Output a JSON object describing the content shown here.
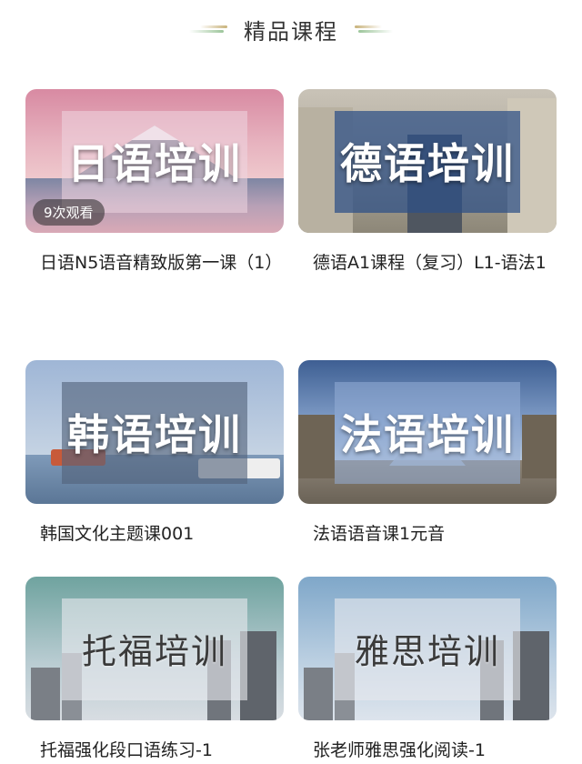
{
  "section": {
    "title": "精品课程"
  },
  "courses": [
    {
      "thumb_label": "日语培训",
      "badge": "9次观看",
      "caption": "日语N5语音精致版第一课（1）"
    },
    {
      "thumb_label": "德语培训",
      "caption": "德语A1课程（复习）L1-语法1"
    },
    {
      "thumb_label": "韩语培训",
      "caption": "韩国文化主题课001"
    },
    {
      "thumb_label": "法语培训",
      "caption": "法语语音课1元音"
    },
    {
      "thumb_label": "托福培训",
      "caption": "托福强化段口语练习-1"
    },
    {
      "thumb_label": "雅思培训",
      "caption": "张老师雅思强化阅读-1"
    }
  ],
  "colors": {
    "japanese_sky": "#e2a6b5",
    "german_overlay": "#2d4f86",
    "korean_overlay": "#52627a",
    "french_overlay": "#6f88b8",
    "city_overlay": "#e6e9ee"
  }
}
